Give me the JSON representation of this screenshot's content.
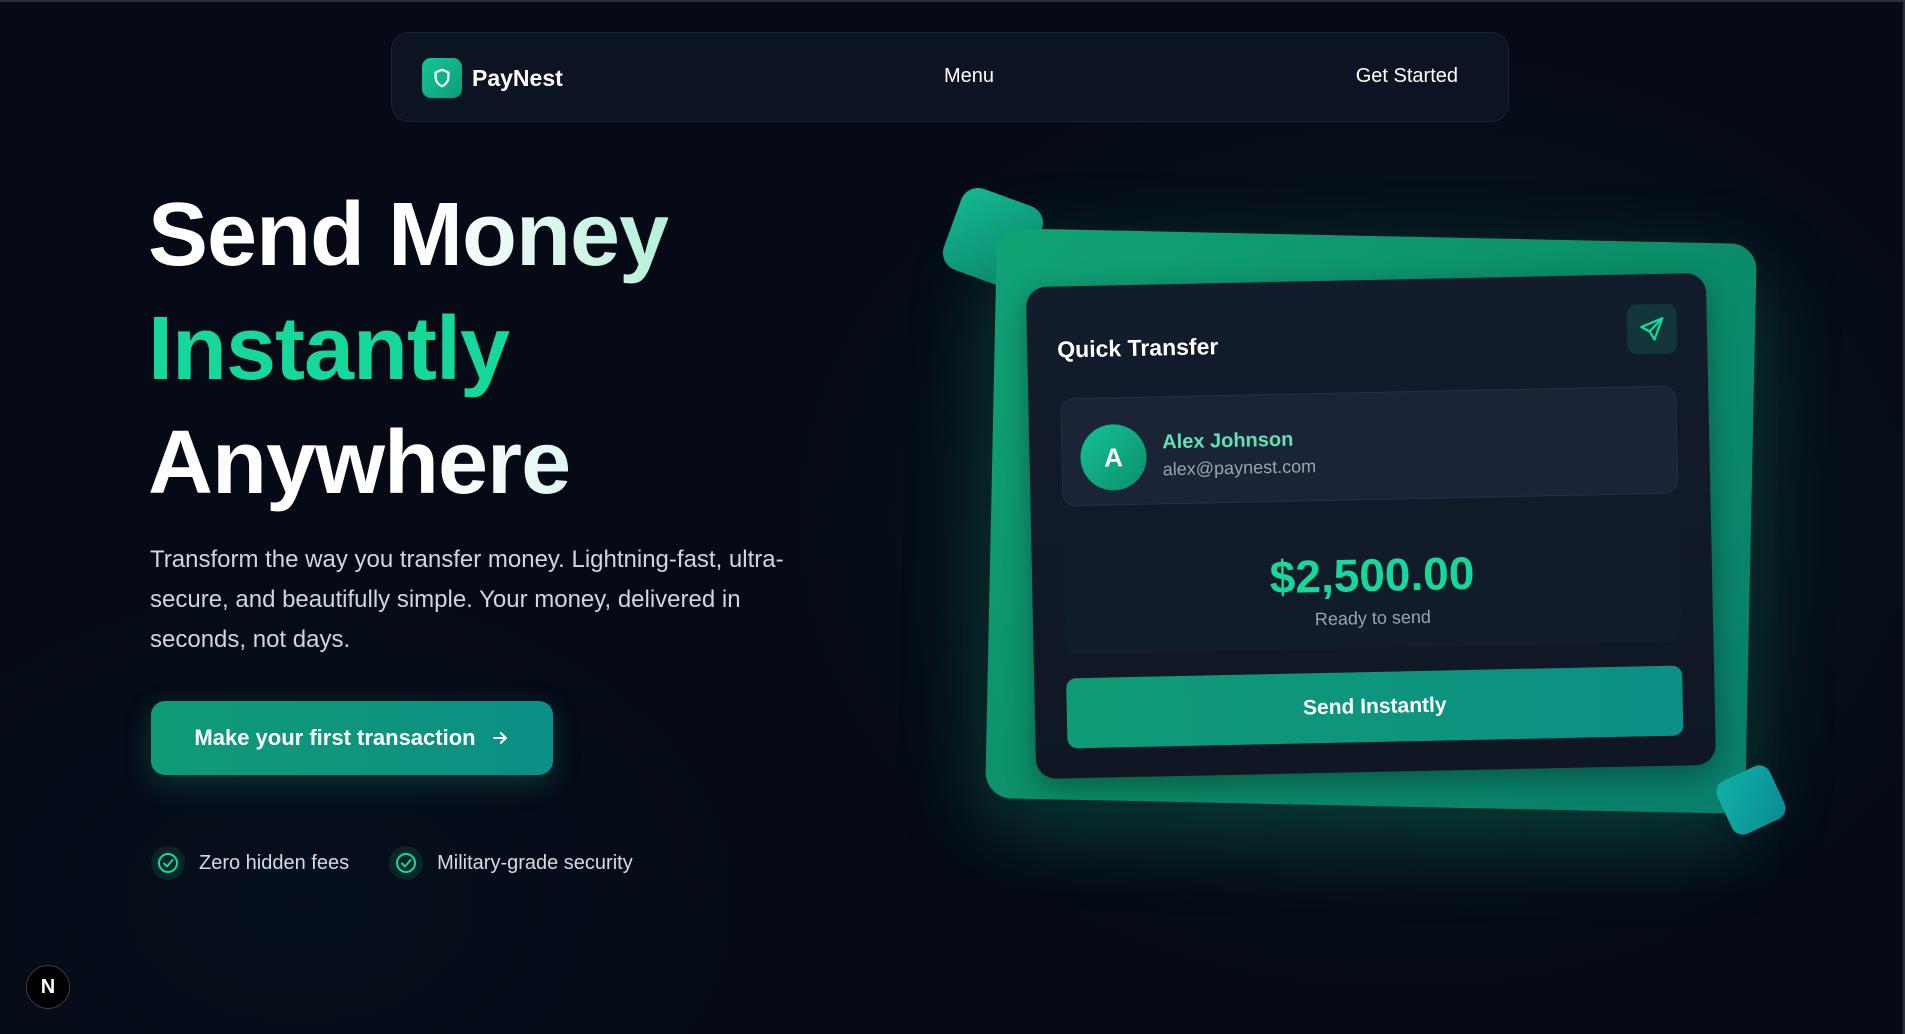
{
  "navbar": {
    "brand": "PayNest",
    "menu_label": "Menu",
    "cta_label": "Get Started"
  },
  "hero": {
    "line1": "Send Money",
    "line2": "Instantly",
    "line3": "Anywhere",
    "description": "Transform the way you transfer money. Lightning-fast, ultra-secure, and beautifully simple. Your money, delivered in seconds, not days.",
    "cta_label": "Make your first transaction",
    "features": [
      {
        "label": "Zero hidden fees",
        "icon": "check-circle-icon"
      },
      {
        "label": "Military-grade security",
        "icon": "check-circle-icon"
      }
    ]
  },
  "transfer_card": {
    "title": "Quick Transfer",
    "recipient": {
      "initial": "A",
      "name": "Alex Johnson",
      "email": "alex@paynest.com"
    },
    "amount": "$2,500.00",
    "amount_caption": "Ready to send",
    "send_label": "Send Instantly"
  },
  "dev_badge": {
    "letter": "N"
  },
  "colors": {
    "accent": "#15d89a",
    "accent_dark": "#0f9b75",
    "background": "#050a16",
    "card": "#131c2c"
  },
  "icons": {
    "brand": "shield-icon",
    "send": "paper-plane-icon",
    "cta": "arrow-right-icon"
  }
}
